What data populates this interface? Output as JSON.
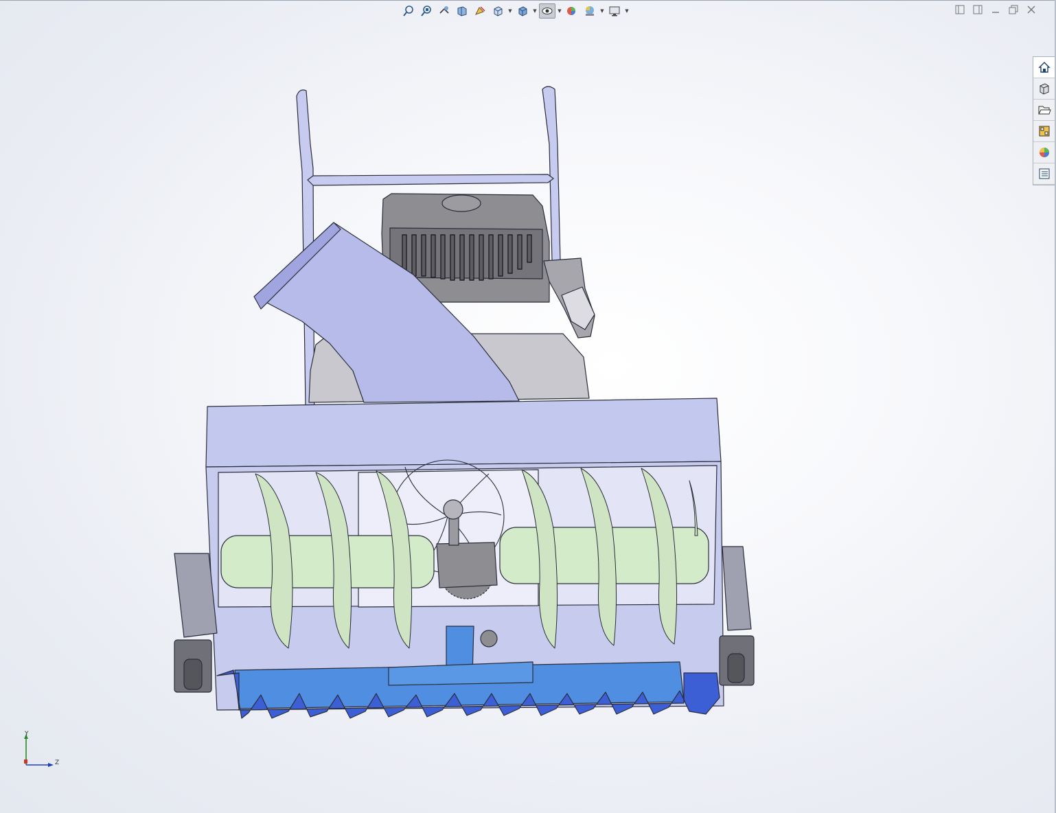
{
  "viewport": {
    "toolbar_icons": [
      "zoom-to-fit-icon",
      "zoom-to-area-icon",
      "previous-view-icon",
      "section-view-icon",
      "dynamic-annotation-icon",
      "view-orientation-icon",
      "display-style-icon",
      "hide-show-items-icon",
      "edit-appearance-icon",
      "apply-scene-icon",
      "view-settings-icon"
    ],
    "window_controls": [
      "tile-left-icon",
      "tile-right-icon",
      "minimize-icon",
      "restore-icon",
      "close-icon"
    ]
  },
  "task_pane": {
    "tabs": [
      "solidworks-resources-icon",
      "design-library-icon",
      "file-explorer-icon",
      "view-palette-icon",
      "appearances-scenes-icon",
      "custom-properties-icon"
    ]
  },
  "triad": {
    "y_label": "Y",
    "z_label": "Z"
  },
  "colors": {
    "housing": "#c3c8ee",
    "auger": "#d3ebc9",
    "scraper": "#4f8ee0",
    "teeth": "#3d5fd6",
    "engine": "#8a8a8e",
    "handle": "#c6cbef"
  }
}
